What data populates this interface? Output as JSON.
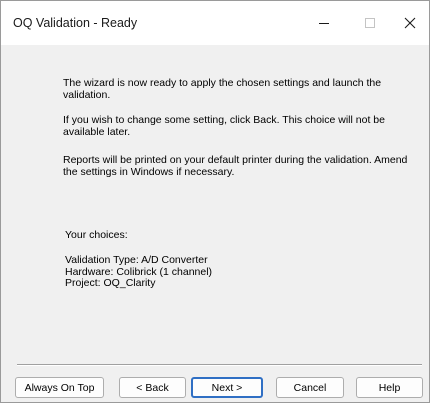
{
  "window": {
    "title": "OQ Validation - Ready"
  },
  "titlebar_icons": {
    "minimize": "minimize-icon",
    "maximize": "maximize-icon",
    "close": "close-icon"
  },
  "content": {
    "para1": "The wizard is now ready to apply the chosen settings and launch the validation.",
    "para2": "If you wish to change some setting, click Back. This choice will not be available later.",
    "para3": "Reports will be printed on your default printer during the validation. Amend the settings in Windows if necessary.",
    "choices_heading": "Your choices:",
    "choices": [
      "Validation Type: A/D Converter",
      "Hardware: Colibrick (1 channel)",
      "Project: OQ_Clarity"
    ]
  },
  "buttons": {
    "always_on_top": "Always On Top",
    "back": "< Back",
    "next": "Next >",
    "cancel": "Cancel",
    "help": "Help"
  },
  "colors": {
    "default_button_border": "#2f6fc4",
    "window_background": "#f0f0f0",
    "titlebar_background": "#ffffff"
  }
}
